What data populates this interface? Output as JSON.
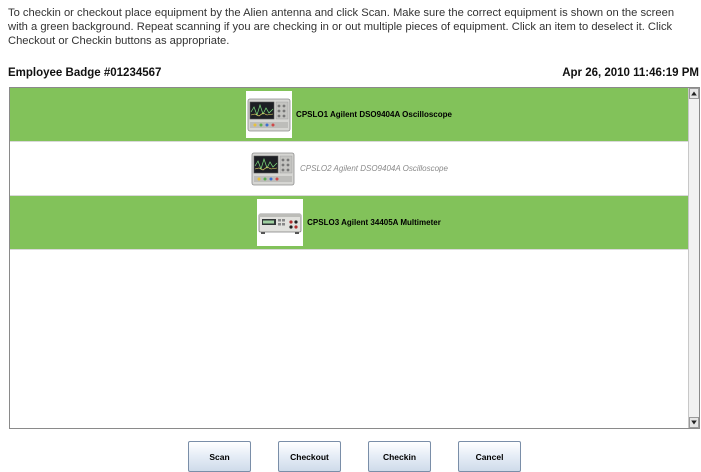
{
  "instructions": "To checkin or checkout place equipment by the Alien antenna and click Scan. Make sure the correct equipment is shown on the screen with a green background. Repeat scanning if you are checking in or out multiple pieces of equipment. Click an item to deselect it. Click Checkout or Checkin buttons as appropriate.",
  "header": {
    "badge": "Employee Badge #01234567",
    "datetime": "Apr 26, 2010 11:46:19 PM"
  },
  "equipment": [
    {
      "label": "CPSLO1  Agilent DSO9404A Oscilloscope",
      "selected": true,
      "icon": "oscilloscope-icon"
    },
    {
      "label": "CPSLO2  Agilent DSO9404A Oscilloscope",
      "selected": false,
      "icon": "oscilloscope-icon"
    },
    {
      "label": "CPSLO3  Agilent 34405A Multimeter",
      "selected": true,
      "icon": "multimeter-icon"
    }
  ],
  "colors": {
    "selected_bg": "#82c25a",
    "unselected_text": "#8a8a8a"
  },
  "buttons": {
    "scan": "Scan",
    "checkout": "Checkout",
    "checkin": "Checkin",
    "cancel": "Cancel"
  }
}
